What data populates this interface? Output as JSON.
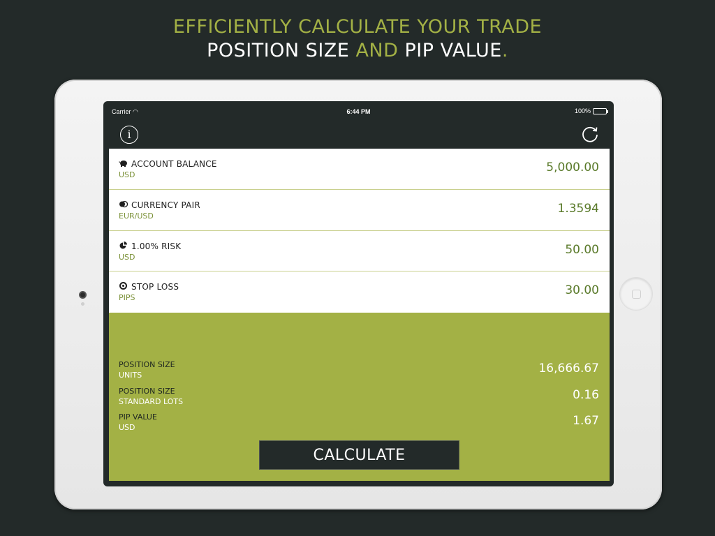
{
  "headline": {
    "line1": "EFFICIENTLY CALCULATE YOUR TRADE",
    "line2_a": "POSITION SIZE ",
    "line2_accent": "AND",
    "line2_b": " PIP VALUE",
    "line2_dot": "."
  },
  "status_bar": {
    "carrier": "Carrier",
    "time": "6:44 PM",
    "battery": "100%"
  },
  "navbar": {
    "info_icon": "info-icon",
    "refresh_icon": "refresh-icon",
    "info_glyph": "i"
  },
  "inputs": [
    {
      "icon": "piggy-bank-icon",
      "label": "ACCOUNT BALANCE",
      "unit": "USD",
      "value": "5,000.00"
    },
    {
      "icon": "currency-coins-icon",
      "label": "CURRENCY PAIR",
      "unit": "EUR/USD",
      "value": "1.3594"
    },
    {
      "icon": "pie-chart-icon",
      "label": "1.00% RISK",
      "unit": "USD",
      "value": "50.00"
    },
    {
      "icon": "target-icon",
      "label": "STOP LOSS",
      "unit": "PIPS",
      "value": "30.00"
    }
  ],
  "results": [
    {
      "label": "POSITION SIZE",
      "unit": "UNITS",
      "value": "16,666.67"
    },
    {
      "label": "POSITION SIZE",
      "unit": "STANDARD LOTS",
      "value": "0.16"
    },
    {
      "label": "PIP VALUE",
      "unit": "USD",
      "value": "1.67"
    }
  ],
  "calculate_label": "CALCULATE",
  "colors": {
    "accent": "#a3b145",
    "background": "#232a29",
    "value_text": "#5a7a2a"
  }
}
